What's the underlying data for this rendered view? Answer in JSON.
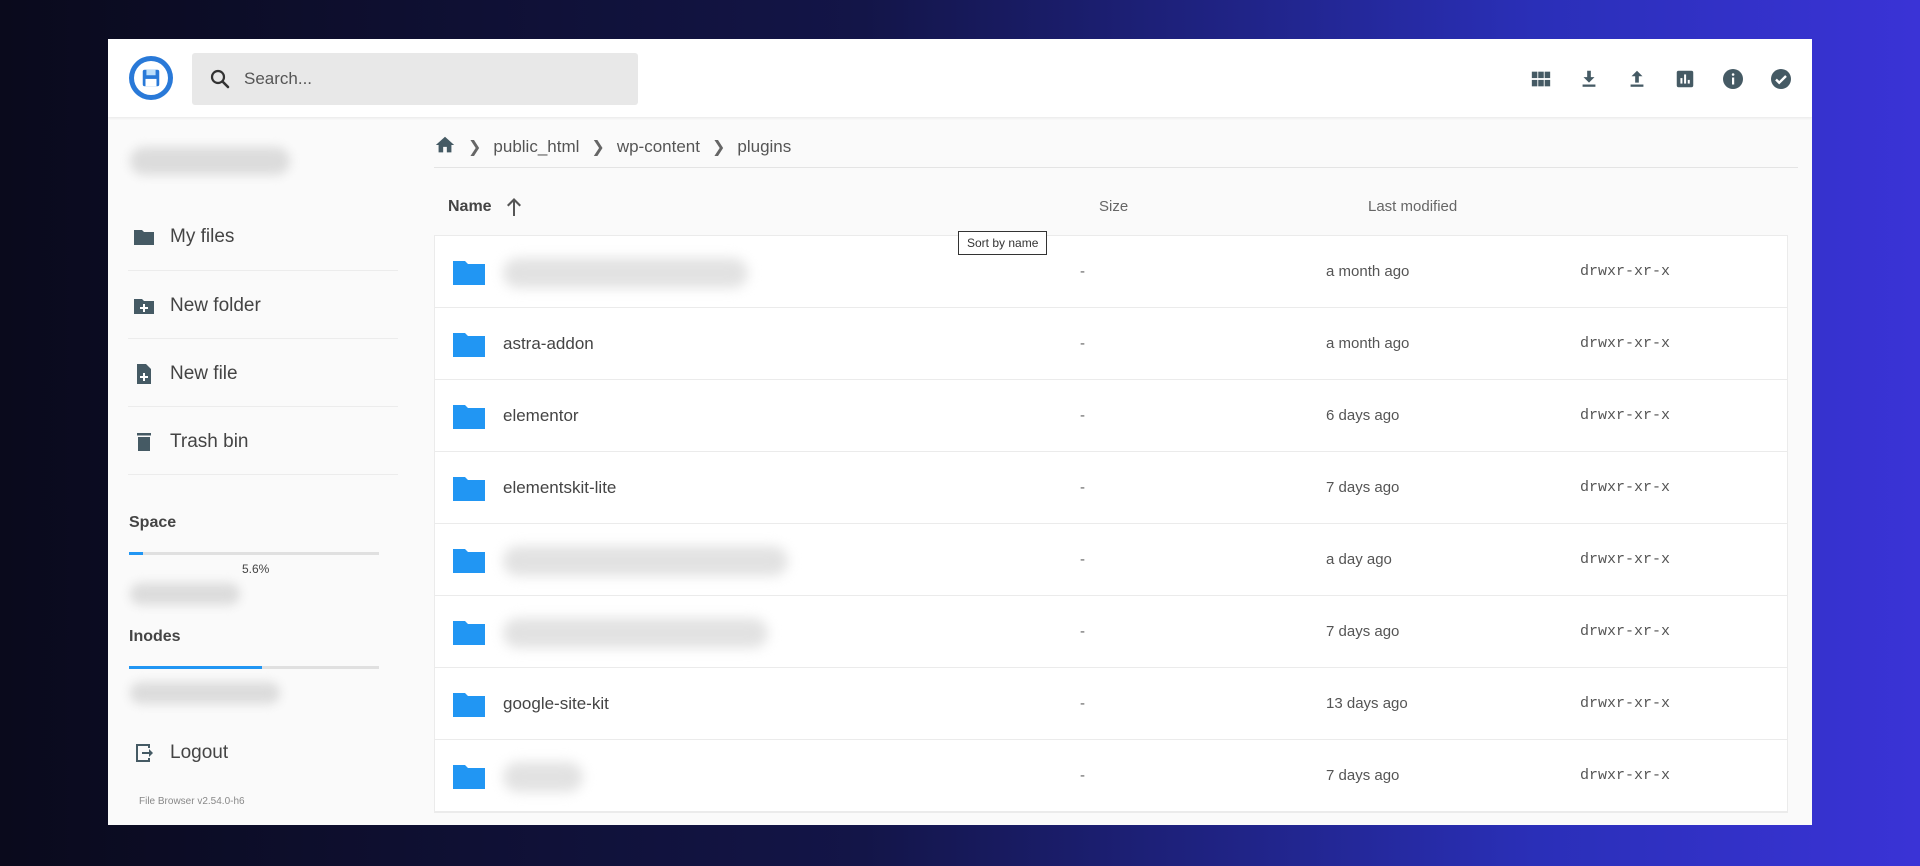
{
  "search": {
    "placeholder": "Search..."
  },
  "toolbar": {
    "icons": [
      "view-grid-icon",
      "download-icon",
      "upload-icon",
      "chart-icon",
      "info-icon",
      "check-circle-icon"
    ]
  },
  "sidebar": {
    "items": [
      {
        "label": "My files",
        "icon": "folder-icon"
      },
      {
        "label": "New folder",
        "icon": "folder-plus-icon"
      },
      {
        "label": "New file",
        "icon": "file-plus-icon"
      },
      {
        "label": "Trash bin",
        "icon": "trash-icon"
      }
    ],
    "space_label": "Space",
    "space_percent": "5.6%",
    "space_fraction": 0.056,
    "inodes_label": "Inodes",
    "inodes_fraction": 0.53,
    "logout_label": "Logout",
    "version": "File Browser v2.54.0-h6"
  },
  "breadcrumb": {
    "home_icon": "home-icon",
    "items": [
      "public_html",
      "wp-content",
      "plugins"
    ]
  },
  "list": {
    "header": {
      "name": "Name",
      "size": "Size",
      "modified": "Last modified"
    },
    "tooltip": "Sort by name",
    "rows": [
      {
        "name": "",
        "size": "-",
        "modified": "a month ago",
        "perm": "drwxr-xr-x"
      },
      {
        "name": "astra-addon",
        "size": "-",
        "modified": "a month ago",
        "perm": "drwxr-xr-x"
      },
      {
        "name": "elementor",
        "size": "-",
        "modified": "6 days ago",
        "perm": "drwxr-xr-x"
      },
      {
        "name": "elementskit-lite",
        "size": "-",
        "modified": "7 days ago",
        "perm": "drwxr-xr-x"
      },
      {
        "name": "",
        "size": "-",
        "modified": "a day ago",
        "perm": "drwxr-xr-x"
      },
      {
        "name": "",
        "size": "-",
        "modified": "7 days ago",
        "perm": "drwxr-xr-x"
      },
      {
        "name": "google-site-kit",
        "size": "-",
        "modified": "13 days ago",
        "perm": "drwxr-xr-x"
      },
      {
        "name": "",
        "size": "-",
        "modified": "7 days ago",
        "perm": "drwxr-xr-x"
      }
    ]
  },
  "colors": {
    "accent": "#2196f3",
    "logo": "#2979d8",
    "folder": "#2196f3"
  }
}
